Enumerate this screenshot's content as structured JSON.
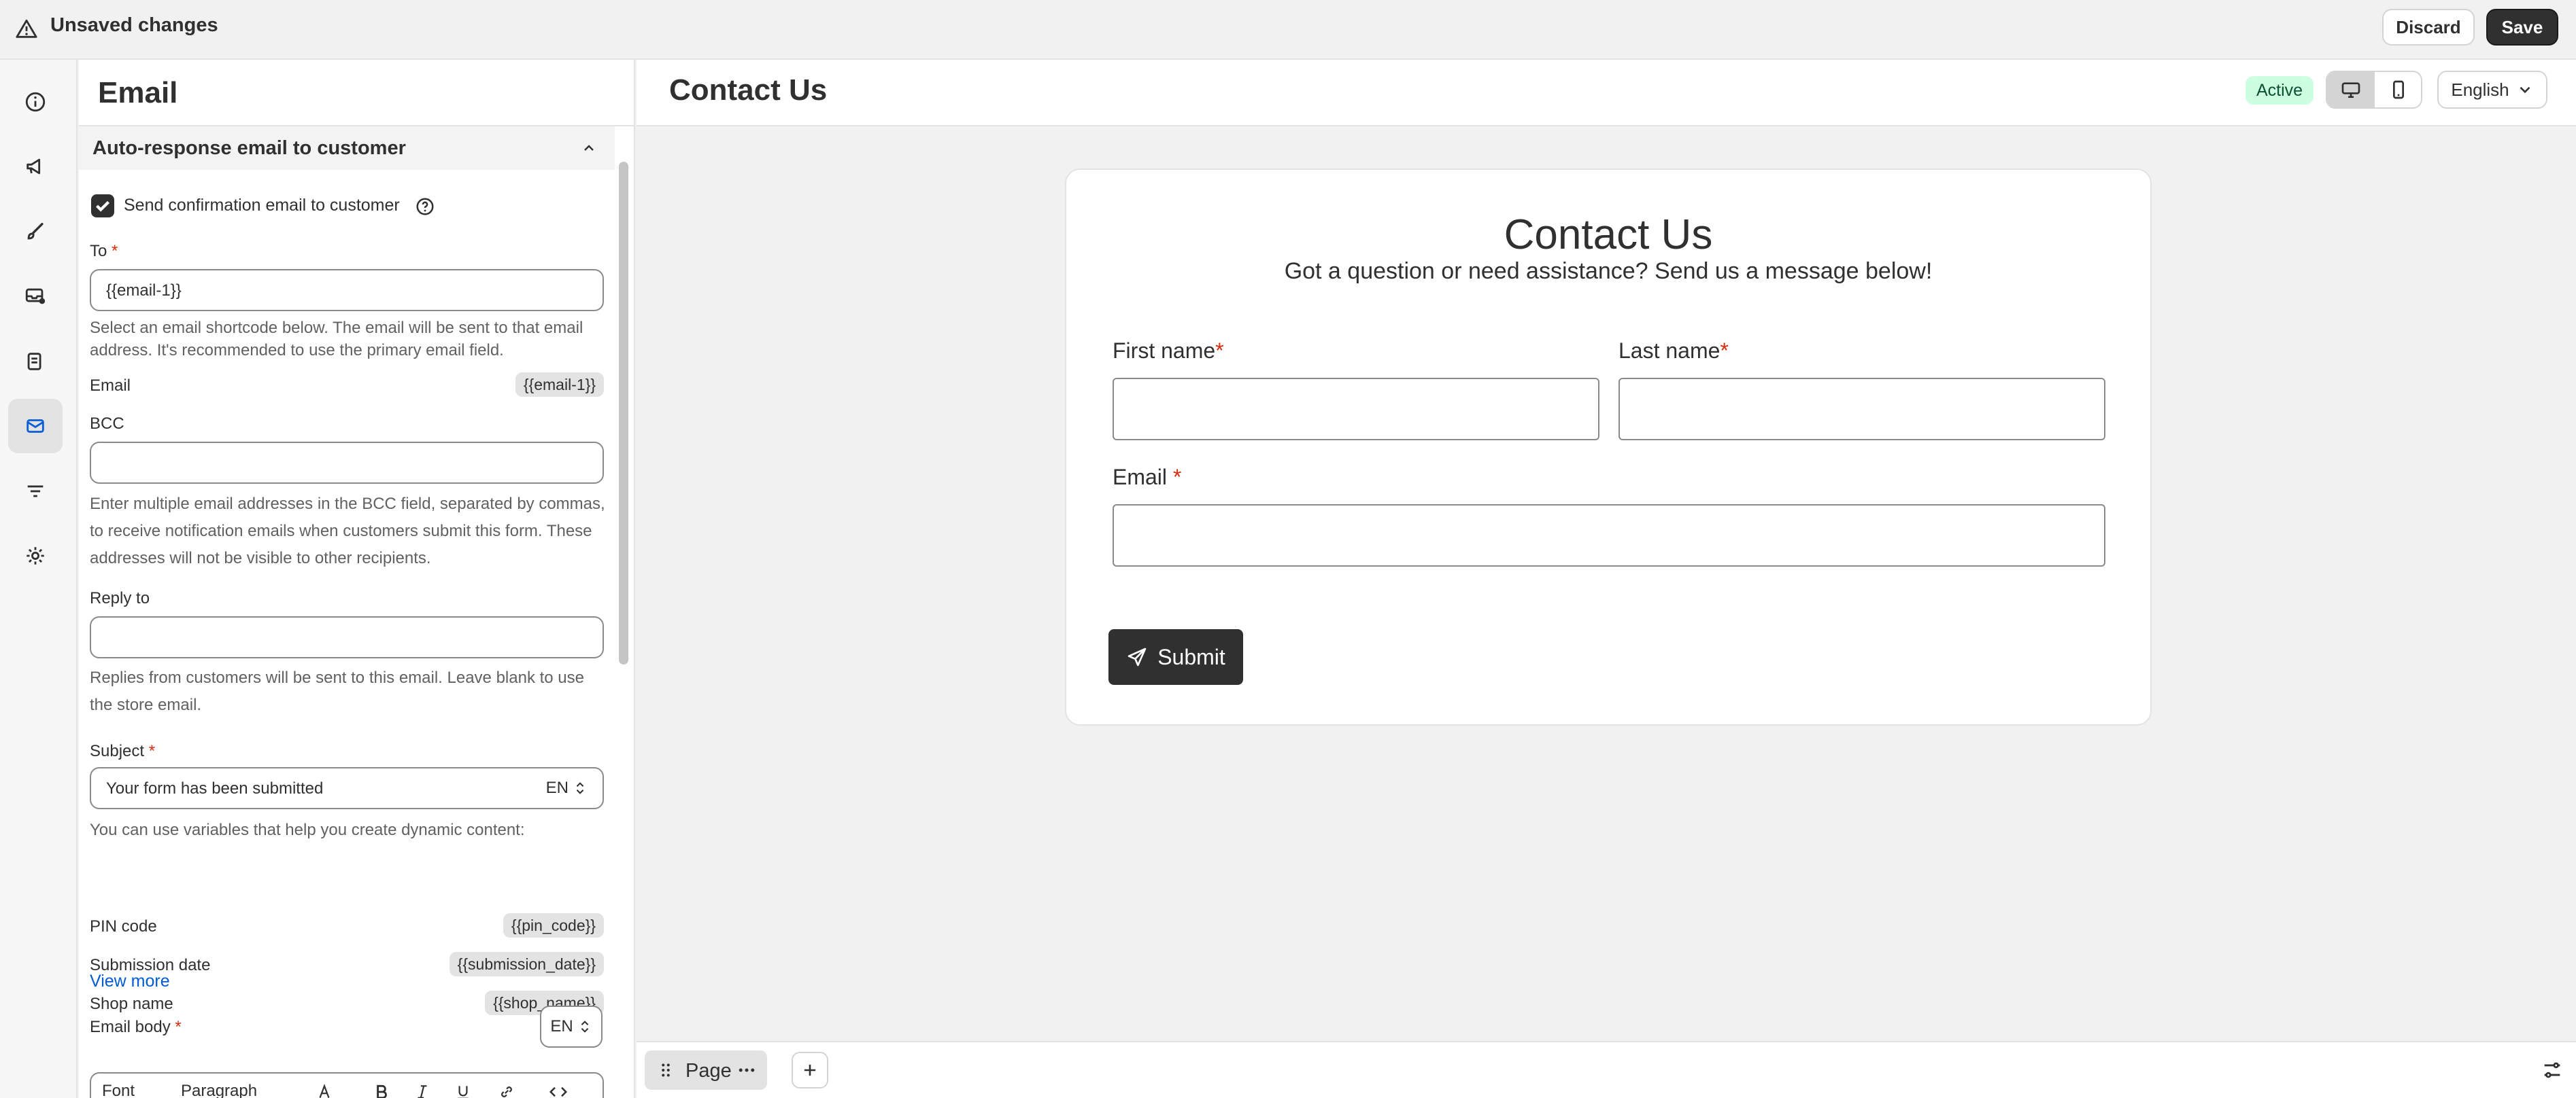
{
  "topbar": {
    "title": "Unsaved changes",
    "discard": "Discard",
    "save": "Save"
  },
  "rail": {
    "icons": [
      "info-icon",
      "megaphone-icon",
      "brush-icon",
      "inbox-icon",
      "receipt-icon",
      "email-icon",
      "filter-icon",
      "gear-icon"
    ],
    "active_index": 5
  },
  "panel": {
    "title": "Email",
    "section_title": "Auto-response email to customer",
    "confirm_checkbox": {
      "label": "Send confirmation email to customer",
      "checked": true
    },
    "to": {
      "label": "To",
      "required": "*",
      "value": "{{email-1}}",
      "help": "Select an email shortcode below. The email will be sent to that email address. It's recommended to use the primary email field."
    },
    "shortcode": {
      "label": "Email",
      "value": "{{email-1}}"
    },
    "bcc": {
      "label": "BCC",
      "value": "",
      "help": "Enter multiple email addresses in the BCC field, separated by commas, to receive notification emails when customers submit this form. These addresses will not be visible to other recipients."
    },
    "reply_to": {
      "label": "Reply to",
      "value": "",
      "help": "Replies from customers will be sent to this email. Leave blank to use the store email."
    },
    "subject": {
      "label": "Subject",
      "required": "*",
      "value": "Your form has been submitted",
      "lang": "EN"
    },
    "variables_help": "You can use variables that help you create dynamic content:",
    "variables": [
      {
        "name": "PIN code",
        "code": "{{pin_code}}"
      },
      {
        "name": "Submission date",
        "code": "{{submission_date}}"
      },
      {
        "name": "Shop name",
        "code": "{{shop_name}}"
      }
    ],
    "view_more": "View more",
    "email_body": {
      "label": "Email body",
      "required": "*",
      "lang": "EN"
    },
    "toolbar": {
      "font": "Font",
      "paragraph": "Paragraph"
    }
  },
  "canvas": {
    "title": "Contact Us",
    "status": "Active",
    "language": "English",
    "form": {
      "title": "Contact Us",
      "subtitle": "Got a question or need assistance? Send us a message below!",
      "first_name": "First name",
      "last_name": "Last name",
      "email": "Email",
      "required_mark": "*",
      "submit": "Submit"
    },
    "bottom": {
      "page_label": "Page"
    }
  }
}
